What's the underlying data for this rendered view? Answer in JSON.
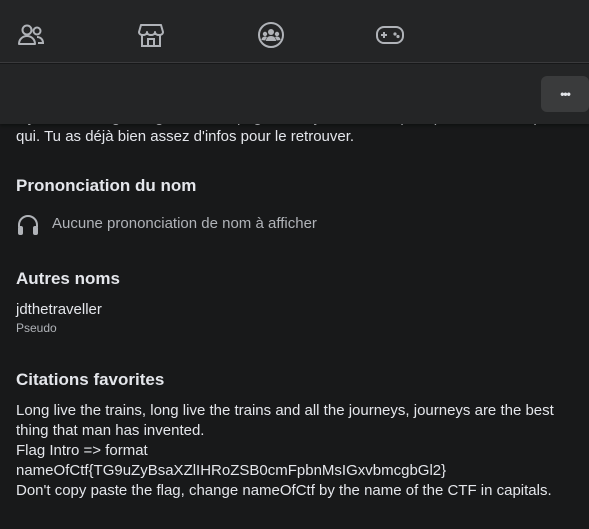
{
  "nav": {
    "icons": [
      "friends-icon",
      "marketplace-icon",
      "groups-icon",
      "gaming-icon"
    ]
  },
  "toolbar": {
    "more_label": "•••"
  },
  "intro": {
    "cut_line": "Il y a aussi un grand-guide sur la page, mais je ne te dirai pas qui c'est, ni de quoi il",
    "continuation": "qui. Tu as déjà bien assez d'infos pour le retrouver."
  },
  "pronunciation": {
    "title": "Prononciation du nom",
    "empty_text": "Aucune prononciation de nom à afficher"
  },
  "other_names": {
    "title": "Autres noms",
    "name": "jdthetraveller",
    "type": "Pseudo"
  },
  "quotes": {
    "title": "Citations favorites",
    "lines": [
      "Long live the trains, long live the trains and all the journeys, journeys are the best",
      "thing that man has invented.",
      "Flag Intro => format",
      "nameOfCtf{TG9uZyBsaXZlIHRoZSB0cmFpbnMsIGxvbmcgbGl2}",
      "Don't copy paste the flag, change nameOfCtf by the name of the CTF in capitals."
    ]
  }
}
